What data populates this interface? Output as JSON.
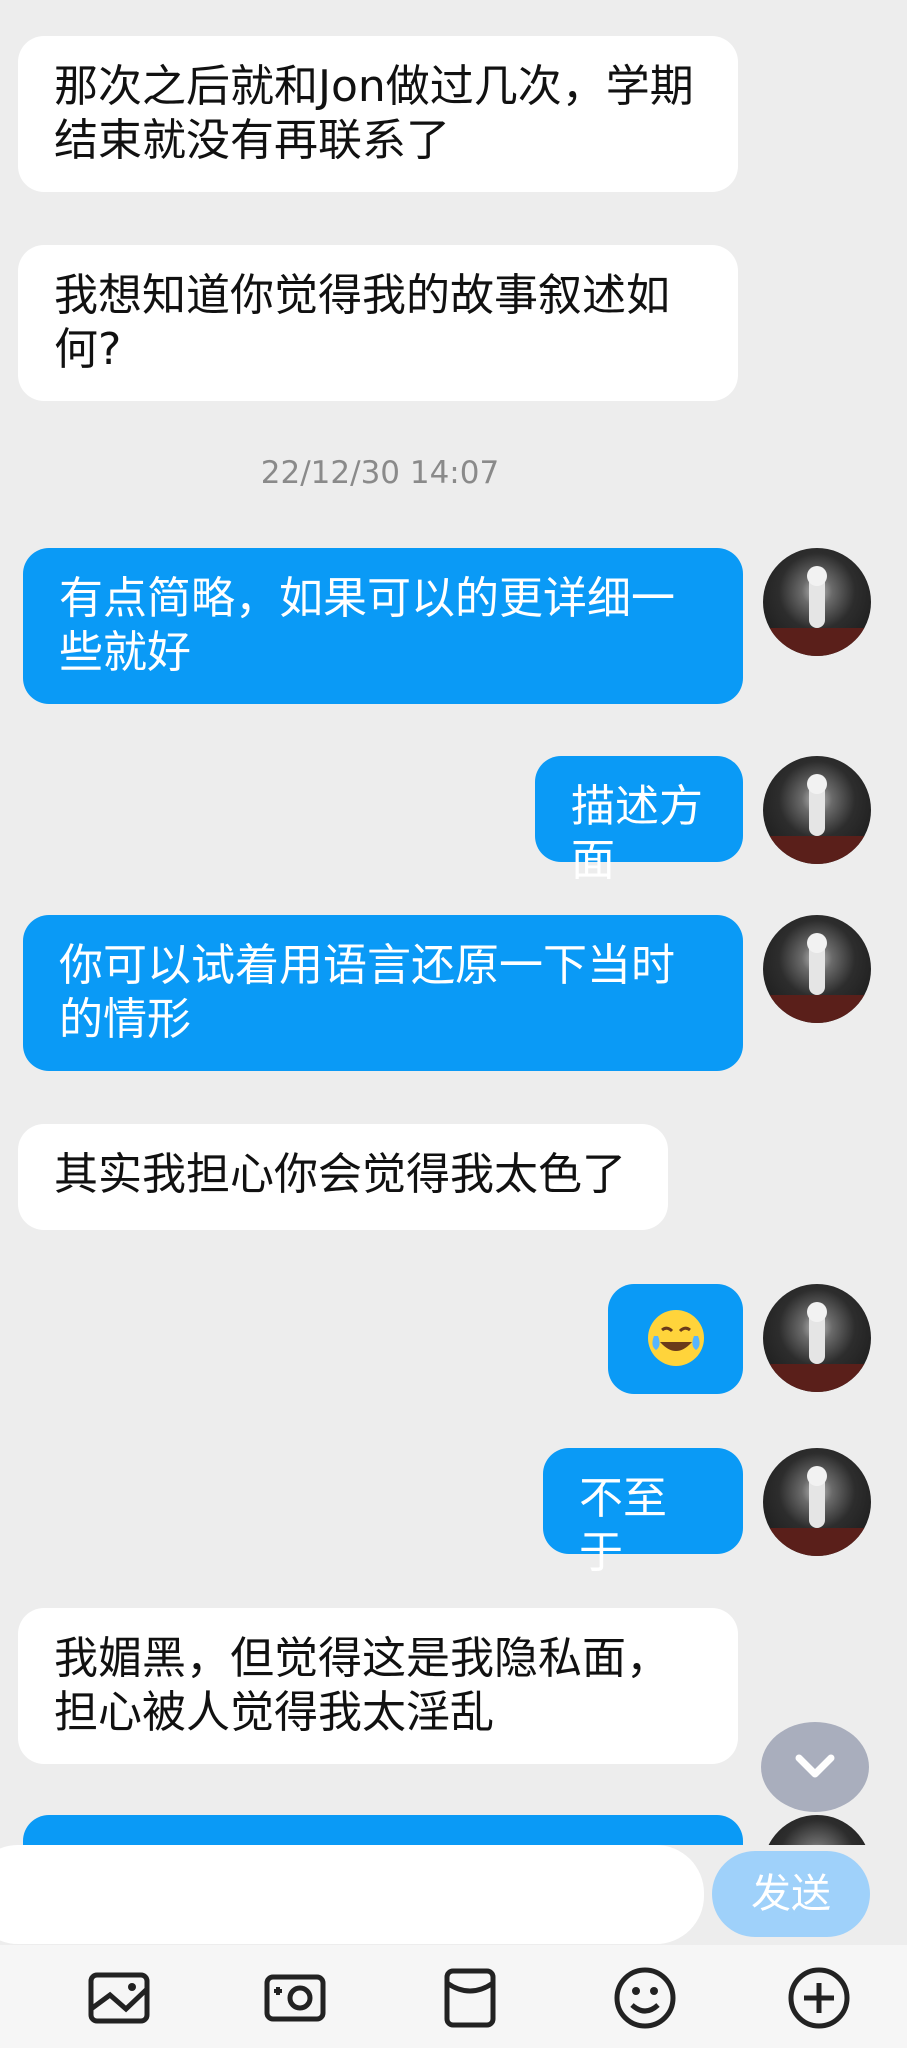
{
  "messages": [
    {
      "text": "那次之后就和Jon做过几次，学期结束就没有再联系了"
    },
    {
      "text": "我想知道你觉得我的故事叙述如何?"
    },
    {
      "text": "有点简略，如果可以的更详细一些就好"
    },
    {
      "text": "描述方面"
    },
    {
      "text": "你可以试着用语言还原一下当时的情形"
    },
    {
      "text": "其实我担心你会觉得我太色了"
    },
    {
      "text": ""
    },
    {
      "text": "不至于"
    },
    {
      "text": "我媚黑，但觉得这是我隐私面，担心被人觉得我太淫乱"
    }
  ],
  "timestamp": "22/12/30 14:07",
  "input": {
    "placeholder": "",
    "value": ""
  },
  "send_label": "发送",
  "icons": {
    "avatar": "avatar-image",
    "scroll": "chevron-down-icon",
    "emoji_message": "laughing-tears-emoji",
    "toolbar": [
      "image-icon",
      "camera-icon",
      "red-packet-icon",
      "emoji-icon",
      "plus-icon"
    ]
  },
  "colors": {
    "outgoing_bubble": "#0a9af6",
    "incoming_bubble": "#ffffff",
    "background": "#ededed",
    "send_button": "#9fd1fa"
  }
}
